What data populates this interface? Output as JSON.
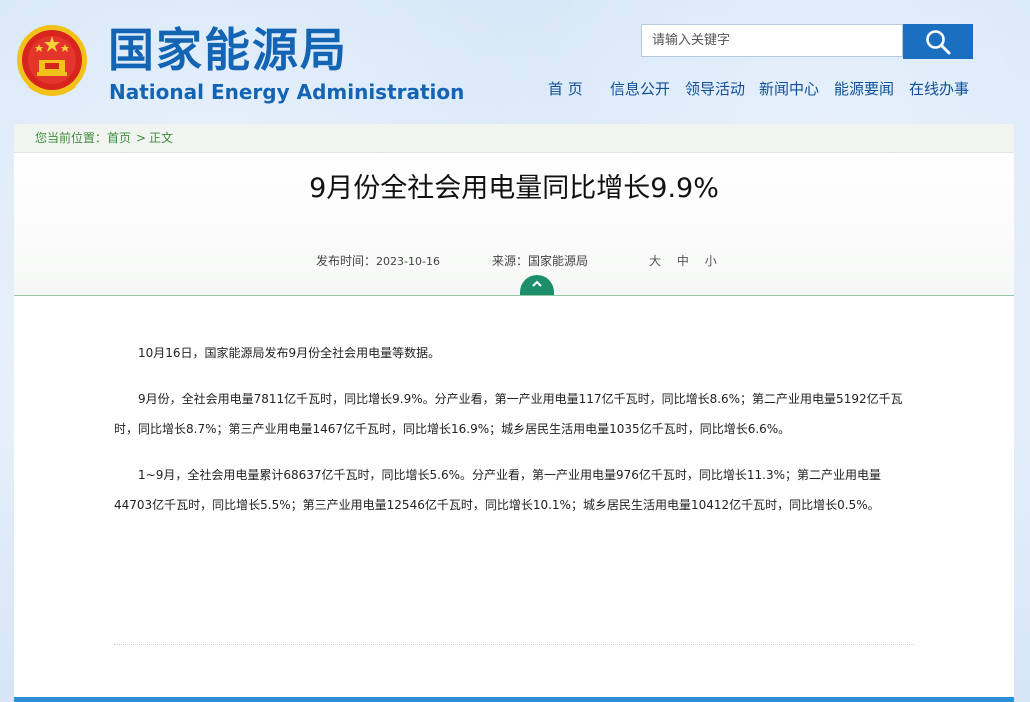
{
  "header": {
    "site_title_cn": "国家能源局",
    "site_title_en": "National Energy Administration",
    "search": {
      "placeholder": "请输入关键字"
    },
    "nav": [
      "首 页",
      "信息公开",
      "领导活动",
      "新闻中心",
      "能源要闻",
      "在线办事"
    ]
  },
  "breadcrumb": {
    "prefix": "您当前位置：",
    "home": "首页",
    "separator": ">",
    "current": "正文"
  },
  "article": {
    "title": "9月份全社会用电量同比增长9.9%",
    "publish_label": "发布时间：",
    "publish_date": "2023-10-16",
    "source_label": "来源：",
    "source": "国家能源局",
    "font_sizes": [
      "大",
      "中",
      "小"
    ],
    "paragraphs": [
      "10月16日，国家能源局发布9月份全社会用电量等数据。",
      "9月份，全社会用电量7811亿千瓦时，同比增长9.9%。分产业看，第一产业用电量117亿千瓦时，同比增长8.6%；第二产业用电量5192亿千瓦时，同比增长8.7%；第三产业用电量1467亿千瓦时，同比增长16.9%；城乡居民生活用电量1035亿千瓦时，同比增长6.6%。",
      "1~9月，全社会用电量累计68637亿千瓦时，同比增长5.6%。分产业看，第一产业用电量976亿千瓦时，同比增长11.3%；第二产业用电量44703亿千瓦时，同比增长5.5%；第三产业用电量12546亿千瓦时，同比增长10.1%；城乡居民生活用电量10412亿千瓦时，同比增长0.5%。"
    ]
  },
  "colors": {
    "brand_blue": "#1464b4",
    "search_button": "#1a6fc0",
    "breadcrumb_green": "#3f8d3a",
    "accent_green": "#1c8f6a"
  },
  "icons": {
    "emblem": "national-emblem-icon",
    "search": "search-icon",
    "collapse": "chevron-up-icon"
  }
}
